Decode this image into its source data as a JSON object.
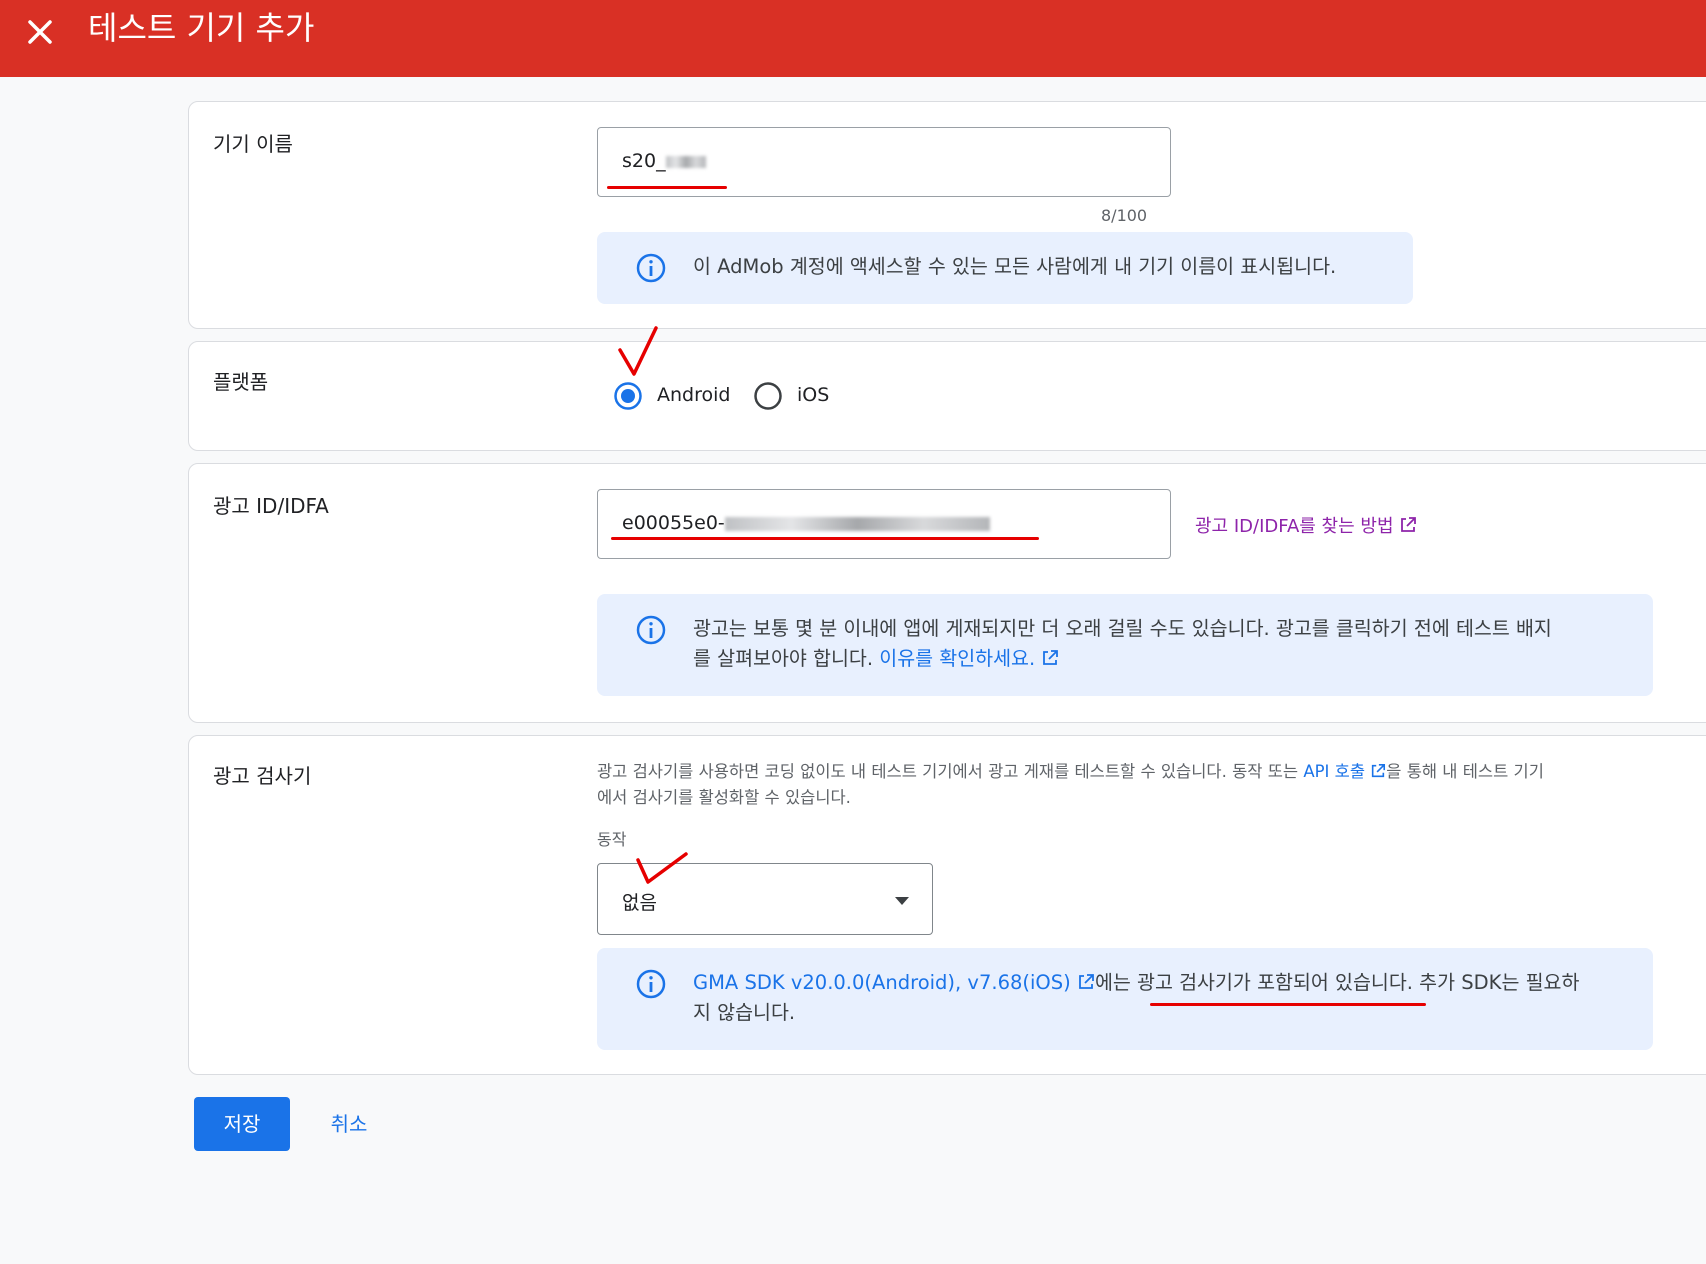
{
  "header": {
    "title": "테스트 기기 추가"
  },
  "device_name": {
    "label": "기기 이름",
    "value": "s20_",
    "counter": "8/100",
    "info": "이 AdMob 계정에 액세스할 수 있는 모든 사람에게 내 기기 이름이 표시됩니다."
  },
  "platform": {
    "label": "플랫폼",
    "options": [
      "Android",
      "iOS"
    ],
    "selected": "Android"
  },
  "ad_id": {
    "label": "광고 ID/IDFA",
    "value": "e00055e0-",
    "help_link": "광고 ID/IDFA를 찾는 방법",
    "info_part1": "광고는 보통 몇 분 이내에 앱에 게재되지만 더 오래 걸릴 수도 있습니다. 광고를 클릭하기 전에 테스트 배지",
    "info_part2": "를 살펴보아야 합니다.",
    "info_link": "이유를 확인하세요."
  },
  "inspector": {
    "label": "광고 검사기",
    "helper_part1": "광고 검사기를 사용하면 코딩 없이도 내 테스트 기기에서 광고 게재를 테스트할 수 있습니다. 동작 또는",
    "helper_link": "API 호출",
    "helper_part2": "을 통해 내 테스트 기기",
    "helper_part3": "에서 검사기를 활성화할 수 있습니다.",
    "action_label": "동작",
    "action_value": "없음",
    "info_link": "GMA SDK v20.0.0(Android), v7.68(iOS)",
    "info_part1": "에는 광고 검사기가 포함되어 있습니다. 추가 SDK는 필요하",
    "info_part2": "지 않습니다."
  },
  "actions": {
    "save": "저장",
    "cancel": "취소"
  },
  "colors": {
    "header": "#d93025",
    "primary": "#1a73e8",
    "info_bg": "#e8f0fe",
    "annotation": "#e60000"
  }
}
